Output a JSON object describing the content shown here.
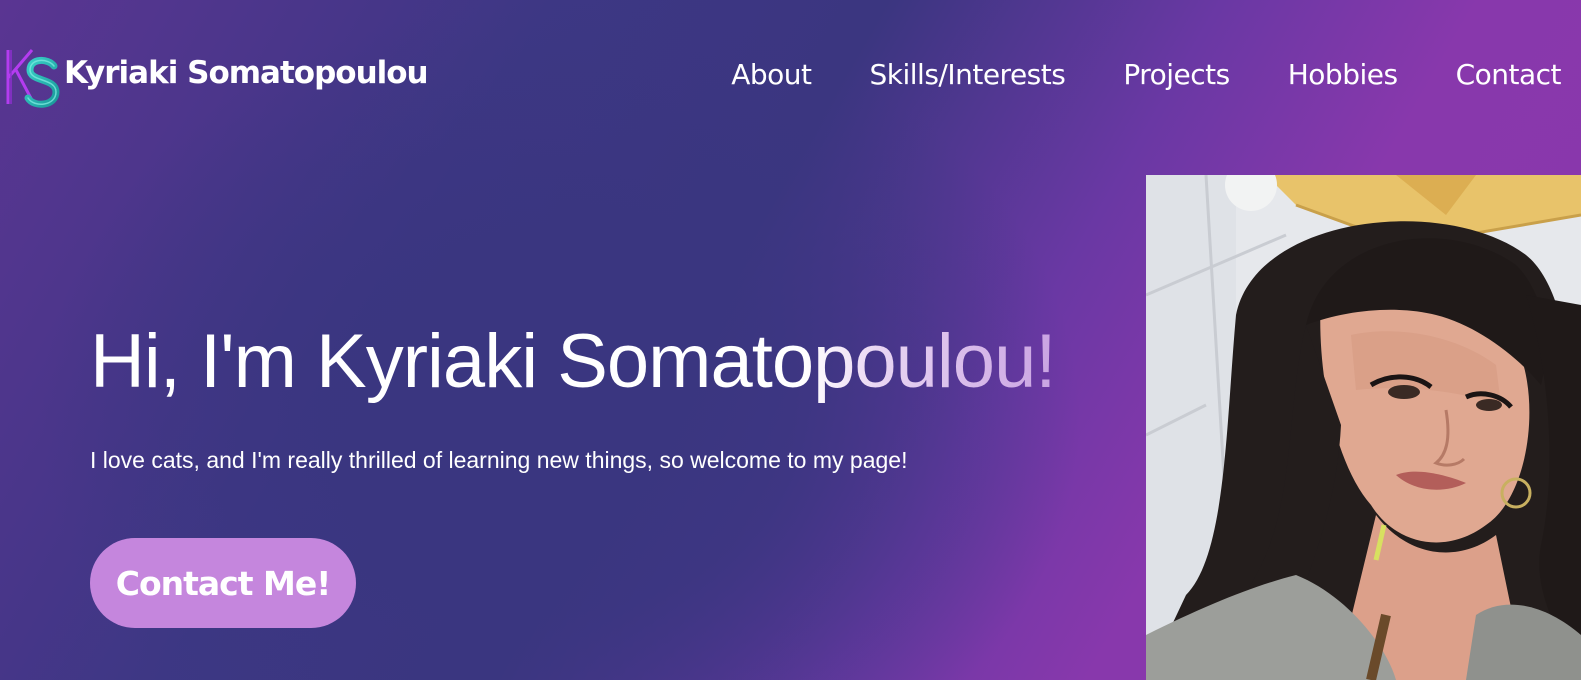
{
  "brand": {
    "logo_text": "KS",
    "name": "Kyriaki Somatopoulou"
  },
  "nav": {
    "items": [
      "About",
      "Skills/Interests",
      "Projects",
      "Hobbies",
      "Contact"
    ]
  },
  "hero": {
    "title": "Hi, I'm Kyriaki Somatopoulou!",
    "subtitle": "I love cats, and I'm really thrilled of learning new things, so welcome to my page!",
    "cta_label": "Contact Me!"
  },
  "photo": {
    "subject": "portrait-photo"
  },
  "colors": {
    "background_start": "#5a3592",
    "background_mid": "#3b3680",
    "background_end": "#8b36ab",
    "cta": "#c586dd",
    "text": "#ffffff"
  }
}
